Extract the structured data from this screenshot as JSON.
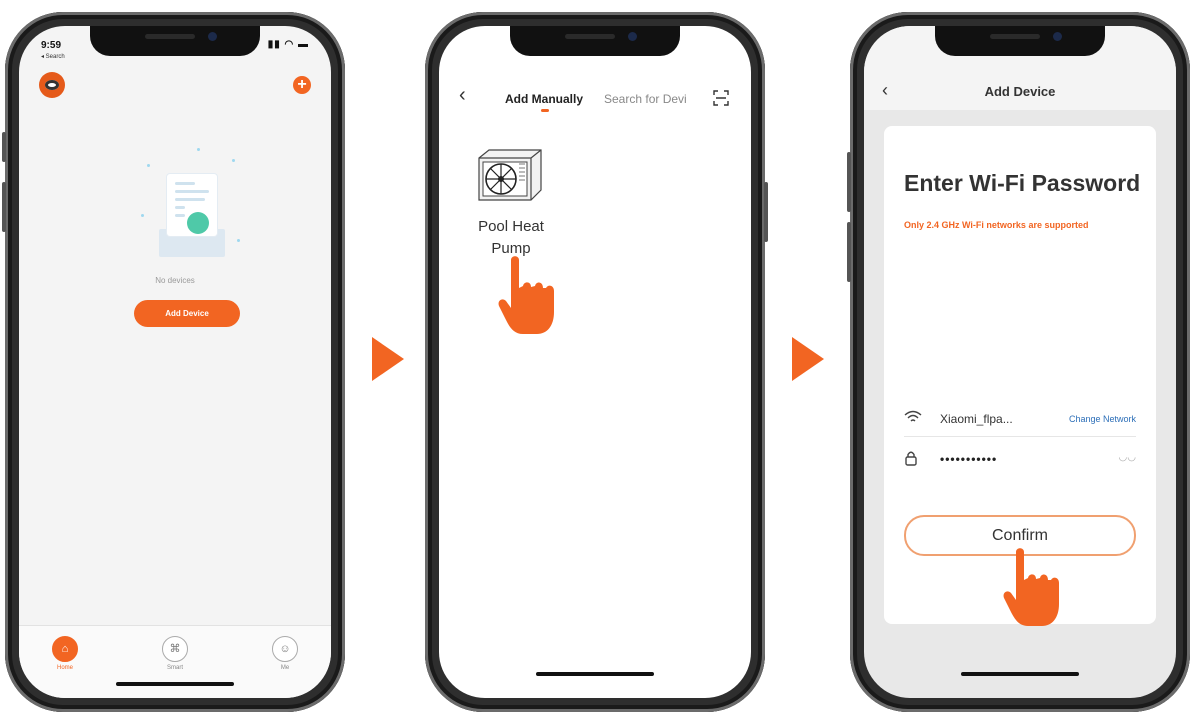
{
  "colors": {
    "accent": "#f26522",
    "link": "#2d6fb8"
  },
  "screen1": {
    "status": {
      "time": "9:59",
      "back": "◂ Search",
      "icons": "▮▮ ◠ ▬"
    },
    "empty_text": "No devices",
    "add_device_label": "Add Device",
    "tabs": [
      {
        "label": "Home",
        "icon": "home-icon"
      },
      {
        "label": "Smart",
        "icon": "smart-icon"
      },
      {
        "label": "Me",
        "icon": "me-icon"
      }
    ]
  },
  "screen2": {
    "tab_manual": "Add Manually",
    "tab_search": "Search for Devi",
    "device_label": "Pool Heat Pump",
    "device_icon": "heat-pump-icon"
  },
  "screen3": {
    "nav_title": "Add Device",
    "heading": "Enter Wi-Fi Password",
    "note": "Only 2.4 GHz Wi-Fi networks are supported",
    "network_name": "Xiaomi_flpa...",
    "change_network": "Change Network",
    "password": "•••••••••••",
    "confirm_label": "Confirm"
  }
}
